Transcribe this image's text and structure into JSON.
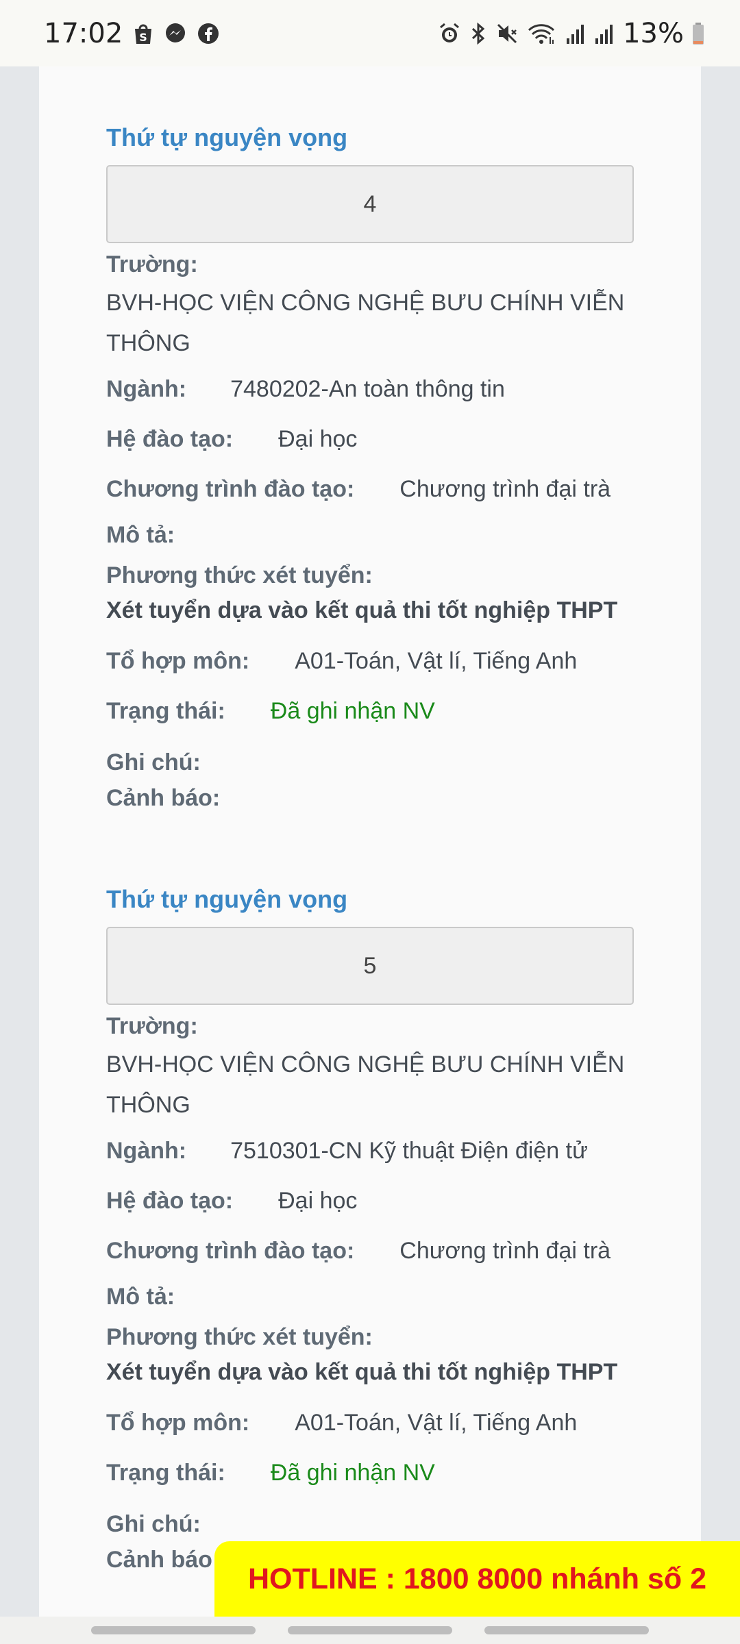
{
  "status_bar": {
    "time": "17:02",
    "battery": "13%",
    "left_icons": [
      "shopee-icon",
      "messenger-icon",
      "facebook-icon"
    ],
    "right_icons": [
      "alarm-icon",
      "bluetooth-icon",
      "mute-icon",
      "wifi-icon",
      "signal-icon",
      "signal-icon",
      "battery-icon"
    ]
  },
  "labels": {
    "order_title": "Thứ tự nguyện vọng",
    "school": "Trường:",
    "major": "Ngành:",
    "training_type": "Hệ đào tạo:",
    "program": "Chương trình đào tạo:",
    "description": "Mô tả:",
    "method": "Phương thức xét tuyển:",
    "subjects": "Tổ hợp môn:",
    "status": "Trạng thái:",
    "note": "Ghi chú:",
    "warning": "Cảnh báo:"
  },
  "choices": [
    {
      "order": "4",
      "school_line1": "BVH-HỌC VIỆN CÔNG NGHỆ BƯU CHÍNH VIỄN",
      "school_line2": "THÔNG",
      "major": "7480202-An toàn thông tin",
      "training_type": "Đại học",
      "program": "Chương trình đại trà",
      "method": "Xét tuyển dựa vào kết quả thi tốt nghiệp THPT",
      "subjects": "A01-Toán, Vật lí, Tiếng Anh",
      "status": "Đã ghi nhận NV"
    },
    {
      "order": "5",
      "school_line1": "BVH-HỌC VIỆN CÔNG NGHỆ BƯU CHÍNH VIỄN",
      "school_line2": "THÔNG",
      "major": "7510301-CN Kỹ thuật Điện điện tử",
      "training_type": "Đại học",
      "program": "Chương trình đại trà",
      "method": "Xét tuyển dựa vào kết quả thi tốt nghiệp THPT",
      "subjects": "A01-Toán, Vật lí, Tiếng Anh",
      "status": "Đã ghi nhận NV"
    }
  ],
  "hotline": "HOTLINE : 1800 8000 nhánh số 2",
  "colors": {
    "title_blue": "#3a86c4",
    "status_green": "#1a8a1a",
    "hotline_bg": "#ffff00",
    "hotline_text": "#e0161f"
  }
}
